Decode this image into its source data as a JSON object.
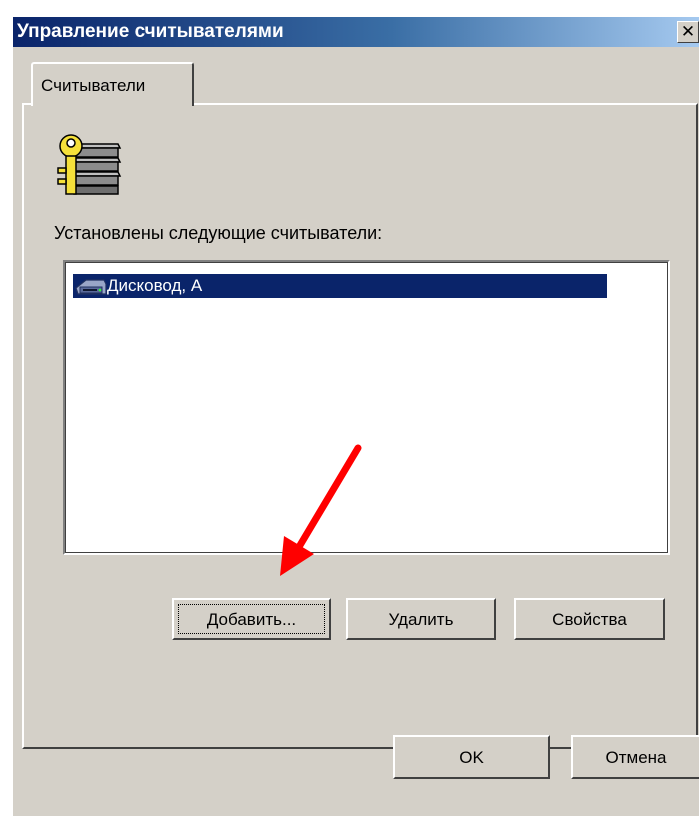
{
  "window": {
    "title": "Управление считывателями",
    "close_glyph": "✕"
  },
  "tabs": [
    {
      "label": "Считыватели",
      "selected": true
    }
  ],
  "main": {
    "icon": "key-card-stack-icon",
    "installed_label": "Установлены следующие считыватели:",
    "readers": [
      {
        "label": "Дисковод, А",
        "icon": "floppy-drive-icon",
        "selected": true
      }
    ]
  },
  "buttons": {
    "add": "Добавить...",
    "remove": "Удалить",
    "properties": "Свойства",
    "ok": "OK",
    "cancel": "Отмена"
  },
  "colors": {
    "title_bar_start": "#0a246a",
    "title_bar_end": "#a6caf0",
    "selection": "#0a246a",
    "dialog_face": "#d4d0c8",
    "annotation_arrow": "#ff0000"
  }
}
